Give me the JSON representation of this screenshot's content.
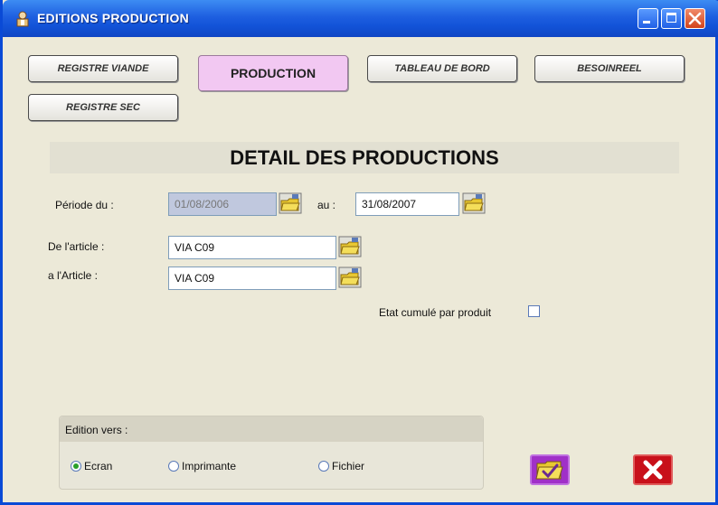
{
  "window": {
    "title": "EDITIONS PRODUCTION"
  },
  "nav": {
    "registre_viande": "REGISTRE VIANDE",
    "production": "PRODUCTION",
    "tableau_de_bord": "TABLEAU DE BORD",
    "besoinreel": "BESOINREEL",
    "registre_sec": "REGISTRE SEC"
  },
  "section": {
    "title": "DETAIL DES PRODUCTIONS"
  },
  "form": {
    "periode_label": "Période du :",
    "periode_from": "01/08/2006",
    "au_label": "au :",
    "periode_to": "31/08/2007",
    "de_article_label": "De l'article :",
    "de_article_value": "VIA C09",
    "a_article_label": "a l'Article :",
    "a_article_value": "VIA C09",
    "etat_label": "Etat cumulé par produit"
  },
  "edition": {
    "title": "Edition vers :",
    "options": [
      "Ecran",
      "Imprimante",
      "Fichier"
    ],
    "selected": "Ecran"
  },
  "icons": {
    "ok": "folder-check-icon",
    "cancel": "close-x-icon",
    "picker": "folder-picker-icon"
  }
}
